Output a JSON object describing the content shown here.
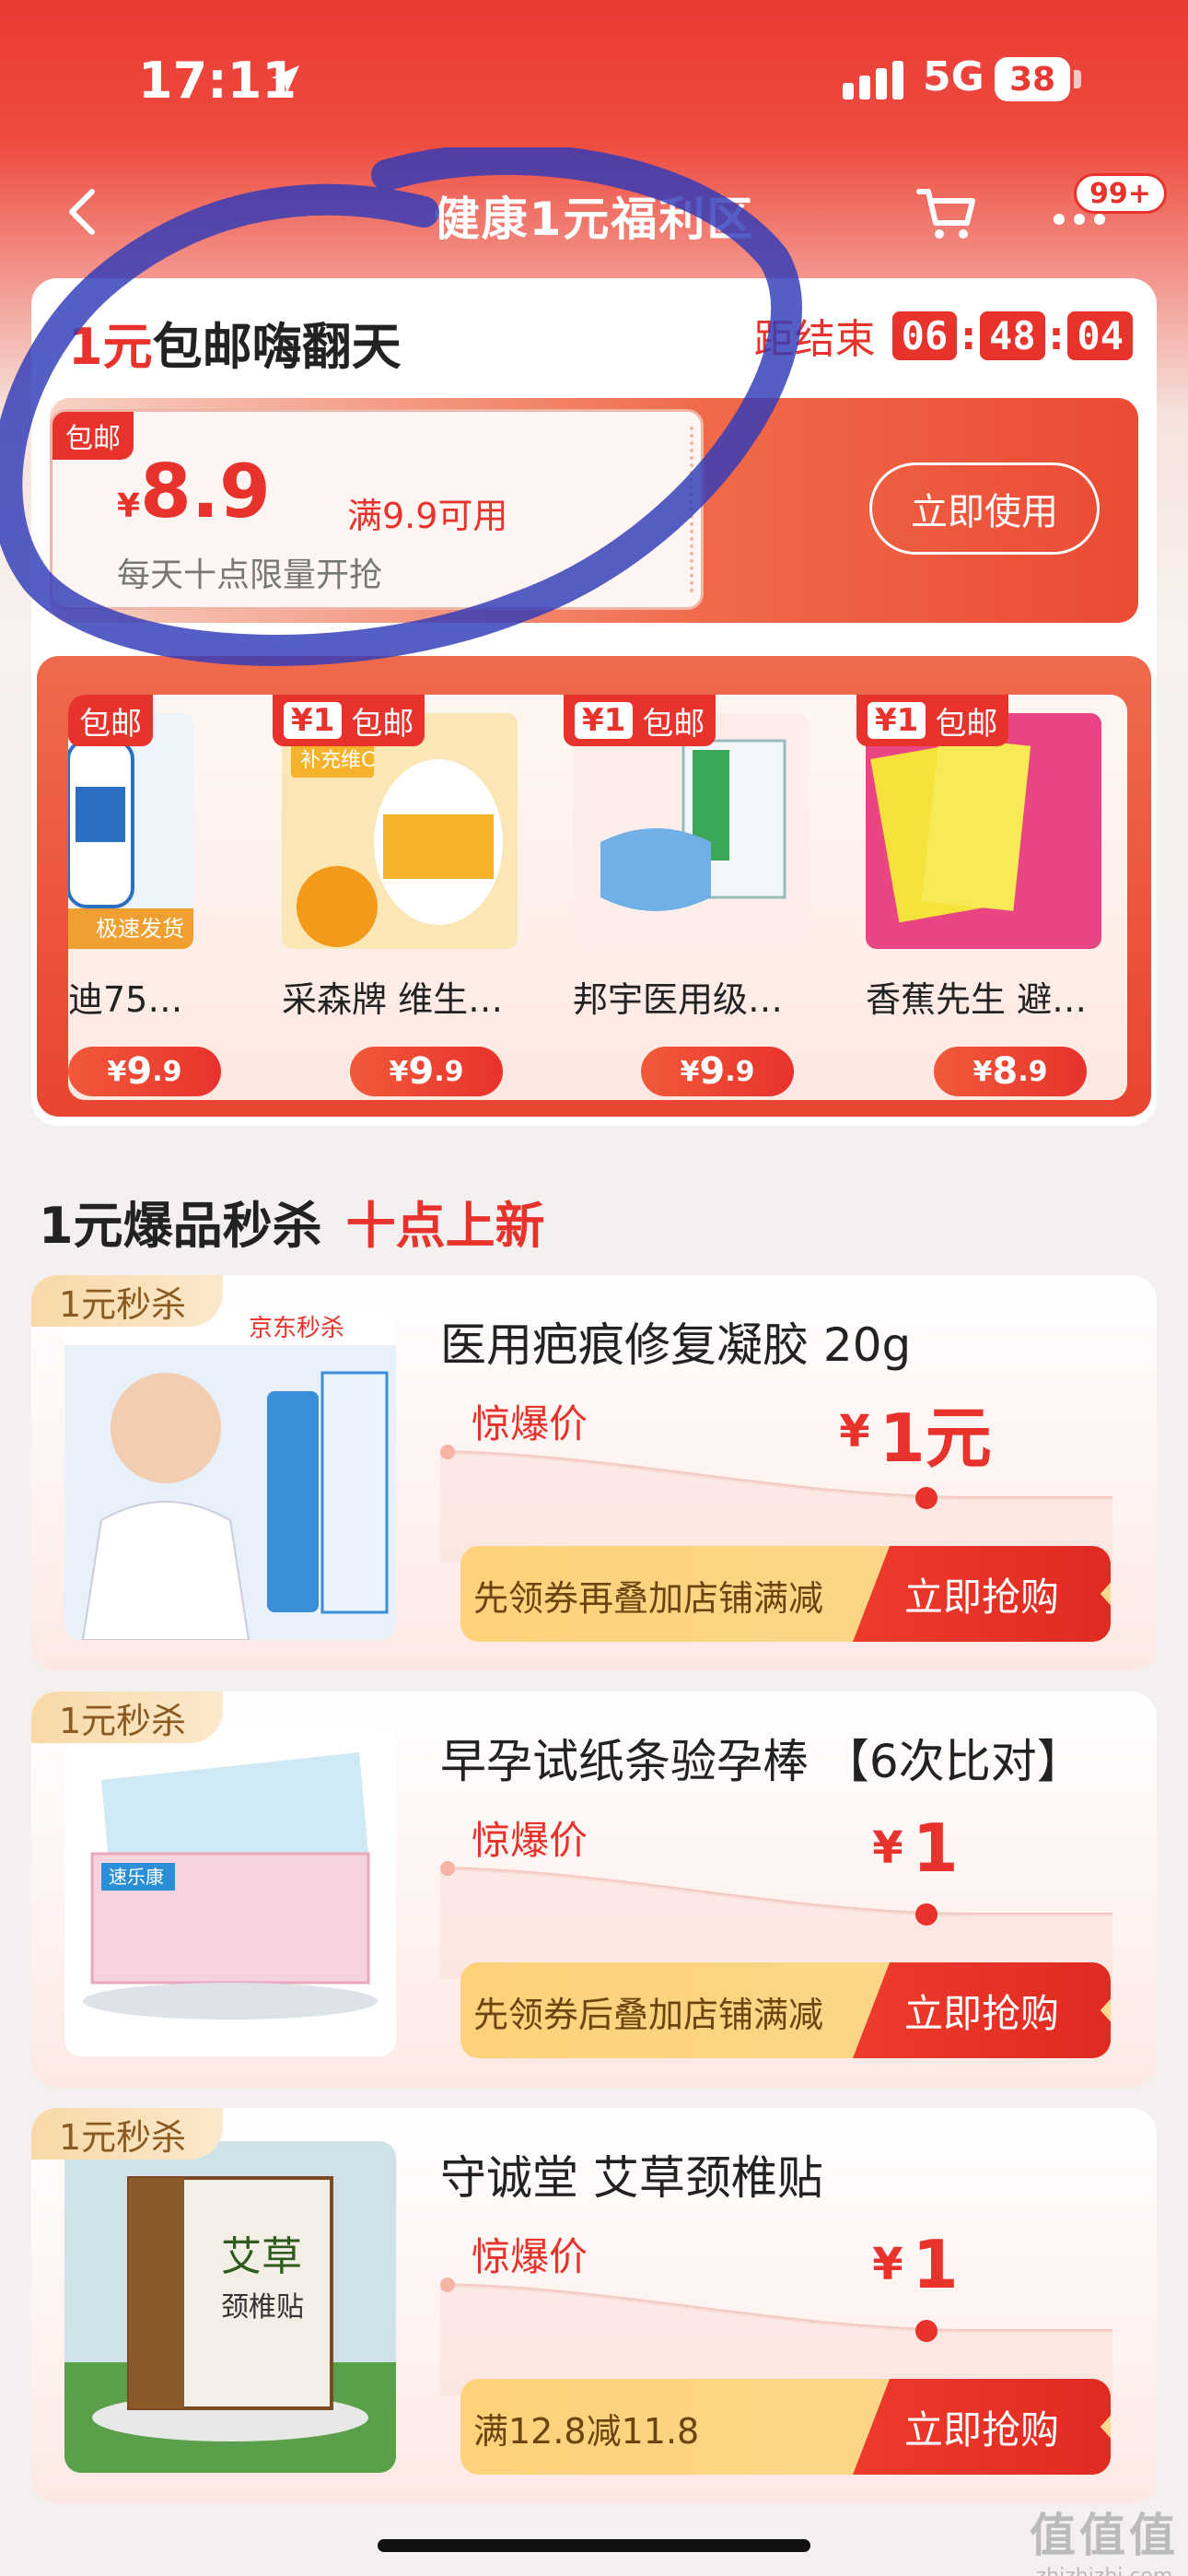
{
  "status_bar": {
    "time": "17:11",
    "network": "5G",
    "battery": "38"
  },
  "header": {
    "title": "健康1元福利区",
    "badge": "99+"
  },
  "promo": {
    "title_red": "1元",
    "title_rest": "包邮嗨翻天",
    "countdown_label": "距结束",
    "countdown": [
      "06",
      "48",
      "04"
    ],
    "coupon": {
      "tag": "包邮",
      "currency": "¥",
      "amount": "8.9",
      "condition": "满9.9可用",
      "description": "每天十点限量开抢"
    },
    "use_button": "立即使用",
    "products": [
      {
        "tag_one": "",
        "tag": "包邮",
        "name": "迪75%…",
        "currency": "¥",
        "price_int": "9",
        "price_dec": ".9"
      },
      {
        "tag_one": "¥1",
        "tag": "包邮",
        "name": "采森牌 维生…",
        "currency": "¥",
        "price_int": "9",
        "price_dec": ".9"
      },
      {
        "tag_one": "¥1",
        "tag": "包邮",
        "name": "邦宇医用级…",
        "currency": "¥",
        "price_int": "9",
        "price_dec": ".9"
      },
      {
        "tag_one": "¥1",
        "tag": "包邮",
        "name": "香蕉先生 避…",
        "currency": "¥",
        "price_int": "8",
        "price_dec": ".9"
      }
    ]
  },
  "section": {
    "title": "1元爆品秒杀",
    "subtitle": "十点上新"
  },
  "deals": [
    {
      "tag": "1元秒杀",
      "name": "医用疤痕修复凝胶 20g",
      "price_label": "惊爆价",
      "currency": "¥",
      "price": "1元",
      "tip": "先领券再叠加店铺满减",
      "button": "立即抢购"
    },
    {
      "tag": "1元秒杀",
      "name": "早孕试纸条验孕棒 【6次比对】",
      "price_label": "惊爆价",
      "currency": "¥",
      "price": "1",
      "tip": "先领券后叠加店铺满减",
      "button": "立即抢购"
    },
    {
      "tag": "1元秒杀",
      "name": "守诚堂 艾草颈椎贴",
      "price_label": "惊爆价",
      "currency": "¥",
      "price": "1",
      "tip": "满12.8减11.8",
      "button": "立即抢购"
    }
  ],
  "watermark": {
    "line1": "值值值",
    "line2": "zhizhizhi.com"
  },
  "colors": {
    "brand_red": "#e8322c",
    "tag_gold": "#f8d9a8",
    "marker_blue": "#2f3ab8"
  }
}
